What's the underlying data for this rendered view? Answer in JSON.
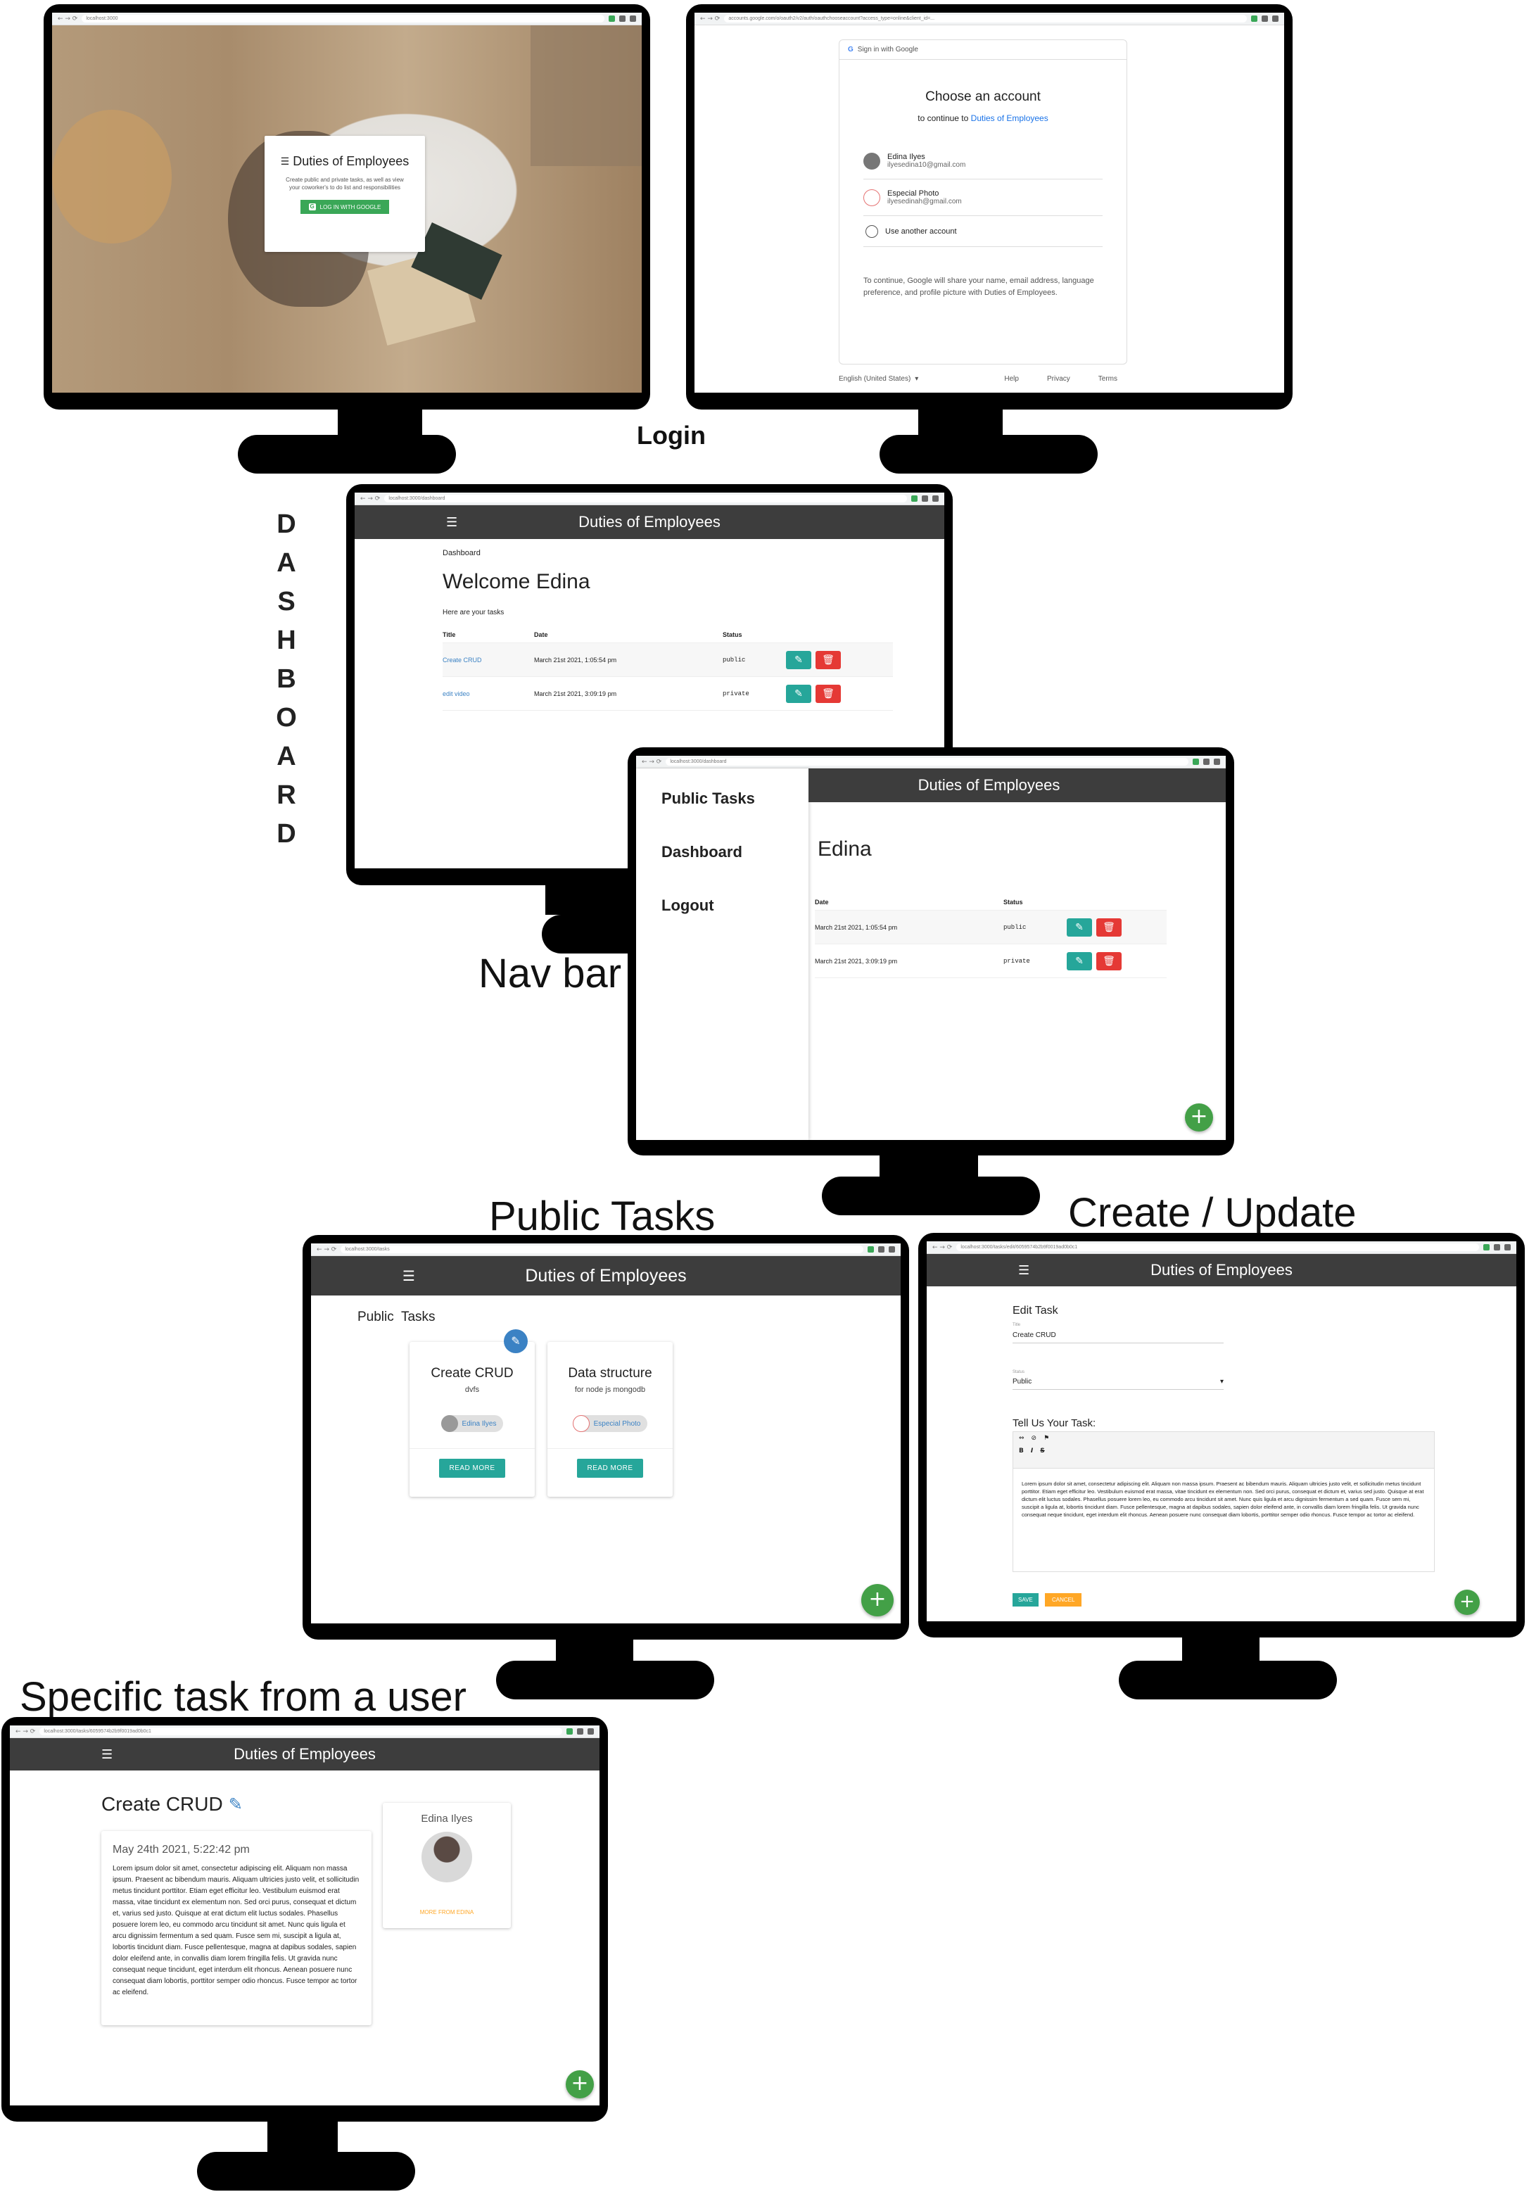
{
  "captions": {
    "login": "Login",
    "dashboard_vertical": [
      "D",
      "A",
      "S",
      "H",
      "B",
      "O",
      "A",
      "R",
      "D"
    ],
    "navbar": "Nav bar",
    "public_tasks": "Public Tasks",
    "create_update": "Create / Update",
    "specific_task": "Specific task from a user"
  },
  "app": {
    "title": "Duties of Employees",
    "menu_icon": "☰",
    "fab_icon": "+"
  },
  "login_screen": {
    "url": "localhost:3000",
    "card_title": "Duties of Employees",
    "card_text": "Create public and private tasks, as well as view your coworker's to do list and responsibilities",
    "google_button": "LOG IN WITH GOOGLE"
  },
  "google_screen": {
    "url": "accounts.google.com/o/oauth2/v2/auth/oauthchooseaccount?access_type=online&client_id=...",
    "header": "Sign in with Google",
    "heading": "Choose an account",
    "continue_prefix": "to continue to",
    "continue_app": "Duties of Employees",
    "accounts": [
      {
        "name": "Edina Ilyes",
        "email": "ilyesedina10@gmail.com"
      },
      {
        "name": "Especial Photo",
        "email": "ilyesedinah@gmail.com"
      }
    ],
    "use_another": "Use another account",
    "disclaimer": "To continue, Google will share your name, email address, language preference, and profile picture with Duties of Employees.",
    "language": "English (United States)",
    "footer_links": [
      "Help",
      "Privacy",
      "Terms"
    ]
  },
  "dashboard": {
    "url": "localhost:3000/dashboard",
    "breadcrumb": "Dashboard",
    "welcome": "Welcome Edina",
    "subtitle": "Here are your tasks",
    "columns": [
      "Title",
      "Date",
      "Status"
    ],
    "rows": [
      {
        "title": "Create CRUD",
        "date": "March 21st 2021, 1:05:54 pm",
        "status": "public"
      },
      {
        "title": "edit video",
        "date": "March 21st 2021, 3:09:19 pm",
        "status": "private"
      }
    ]
  },
  "navbar_screen": {
    "url": "localhost:3000/dashboard",
    "nav_items": [
      "Public Tasks",
      "Dashboard",
      "Logout"
    ],
    "welcome_partial": "Edina",
    "columns": [
      "Date",
      "Status"
    ],
    "rows": [
      {
        "date": "March 21st 2021, 1:05:54 pm",
        "status": "public"
      },
      {
        "date": "March 21st 2021, 3:09:19 pm",
        "status": "private"
      }
    ]
  },
  "public_tasks_screen": {
    "url": "localhost:3000/tasks",
    "heading": "Public  Tasks",
    "cards": [
      {
        "title": "Create CRUD",
        "body": "dvfs",
        "user": "Edina Ilyes",
        "button": "READ MORE"
      },
      {
        "title": "Data structure",
        "body": "for node js mongodb",
        "user": "Especial Photo",
        "button": "READ MORE"
      }
    ]
  },
  "edit_screen": {
    "url": "localhost:3000/tasks/edit/6059574b2b9f0019ad0b0c1",
    "heading": "Edit Task",
    "title_label": "Title",
    "title_value": "Create CRUD",
    "status_label": "Status",
    "status_value": "Public",
    "body_label": "Tell Us Your Task:",
    "toolbar_row1": [
      "⇔",
      "⊘",
      "⚑"
    ],
    "toolbar_row2": [
      "B",
      "I",
      "S"
    ],
    "body_text": "Lorem ipsum dolor sit amet, consectetur adipiscing elit. Aliquam non massa ipsum. Praesent ac bibendum mauris. Aliquam ultricies justo velit, et sollicitudin metus tincidunt porttitor. Etiam eget efficitur leo. Vestibulum euismod erat massa, vitae tincidunt ex elementum non. Sed orci purus, consequat et dictum et, varius sed justo. Quisque at erat dictum elit luctus sodales. Phasellus posuere lorem leo, eu commodo arcu tincidunt sit amet. Nunc quis ligula et arcu dignissim fermentum a sed quam. Fusce sem mi, suscipit a ligula at, lobortis tincidunt diam. Fusce pellentesque, magna at dapibus sodales, sapien dolor eleifend ante, in convallis diam lorem fringilla felis. Ut gravida nunc consequat neque tincidunt, eget interdum elit rhoncus. Aenean posuere nunc consequat diam lobortis, porttitor semper odio rhoncus. Fusce tempor ac tortor ac eleifend.",
    "save": "SAVE",
    "cancel": "CANCEL"
  },
  "specific_screen": {
    "url": "localhost:3000/tasks/6059574b2b9f0019ad0b0c1",
    "title": "Create CRUD",
    "date": "May 24th 2021, 5:22:42 pm",
    "body": "Lorem ipsum dolor sit amet, consectetur adipiscing elit. Aliquam non massa ipsum. Praesent ac bibendum mauris. Aliquam ultricies justo velit, et sollicitudin metus tincidunt porttitor. Etiam eget efficitur leo. Vestibulum euismod erat massa, vitae tincidunt ex elementum non. Sed orci purus, consequat et dictum et, varius sed justo. Quisque at erat dictum elit luctus sodales. Phasellus posuere lorem leo, eu commodo arcu tincidunt sit amet. Nunc quis ligula et arcu dignissim fermentum a sed quam. Fusce sem mi, suscipit a ligula at, lobortis tincidunt diam. Fusce pellentesque, magna at dapibus sodales, sapien dolor eleifend ante, in convallis diam lorem fringilla felis. Ut gravida nunc consequat neque tincidunt, eget interdum elit rhoncus. Aenean posuere nunc consequat diam lobortis, porttitor semper odio rhoncus. Fusce tempor ac tortor ac eleifend.",
    "author": "Edina Ilyes",
    "more_link": "MORE FROM EDINA"
  },
  "colors": {
    "appbar": "#3d3d3d",
    "teal": "#26a69a",
    "red": "#e53935",
    "green_fab": "#43a047",
    "link": "#3b82c4",
    "orange": "#ffa726"
  },
  "icons": {
    "edit": "edit-icon",
    "delete": "trash-icon",
    "add": "plus-icon",
    "menu": "hamburger-menu-icon",
    "google": "google-g-icon"
  }
}
